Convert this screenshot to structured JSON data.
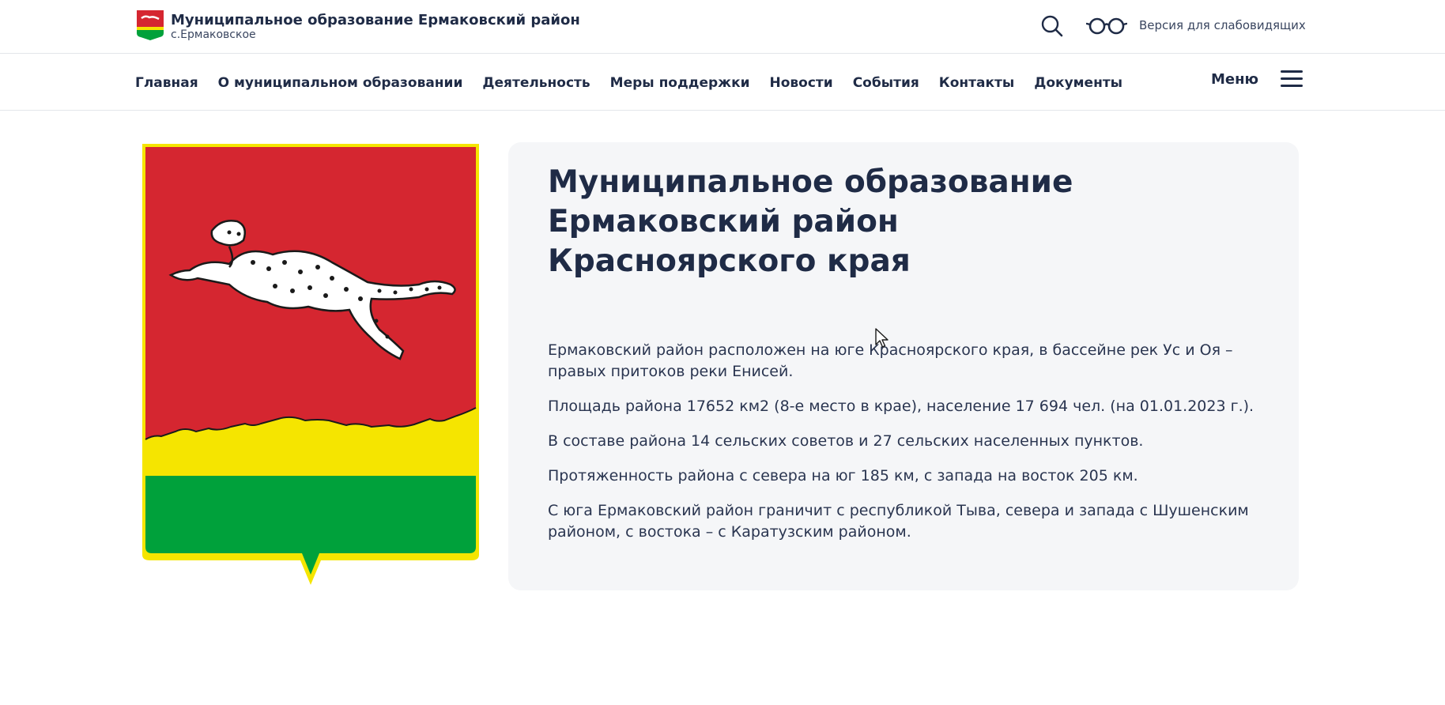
{
  "header": {
    "title": "Муниципальное образование Ермаковский район",
    "subtitle": "с.Ермаковское",
    "accessibility_label": "Версия для слабовидящих",
    "icons": {
      "logo": "coat-of-arms-icon",
      "search": "search-icon",
      "accessibility": "glasses-icon"
    }
  },
  "nav": {
    "items": [
      {
        "label": "Главная"
      },
      {
        "label": "О муниципальном образовании"
      },
      {
        "label": "Деятельность"
      },
      {
        "label": "Меры поддержки"
      },
      {
        "label": "Новости"
      },
      {
        "label": "События"
      },
      {
        "label": "Контакты"
      },
      {
        "label": "Документы"
      }
    ],
    "menu_label": "Меню",
    "menu_icon": "hamburger-icon"
  },
  "main": {
    "image": "coat-of-arms-leopard",
    "title_lines": [
      "Муниципальное образование",
      "Ермаковский район",
      "Красноярского края"
    ],
    "paragraphs": [
      "Ермаковский район расположен на  юге Красноярского края, в бассейне рек Ус и Оя – правых притоков реки Енисей.",
      "Площадь района 17652 км2 (8-е место в крае), население 17 694 чел. (на 01.01.2023 г.).",
      "В составе района 14 сельских советов и 27 сельских населенных пунктов.",
      "Протяженность района с севера на юг 185 км, с запада на восток 205 км.",
      "С юга Ермаковский район граничит с республикой Тыва, севера и запада с Шушенским районом, с востока –  с Каратузским районом."
    ]
  },
  "colors": {
    "text": "#1f2b46",
    "card_bg": "#f5f6f8",
    "coat_red": "#d52630",
    "coat_yellow": "#f5e500",
    "coat_green": "#00a13b"
  }
}
